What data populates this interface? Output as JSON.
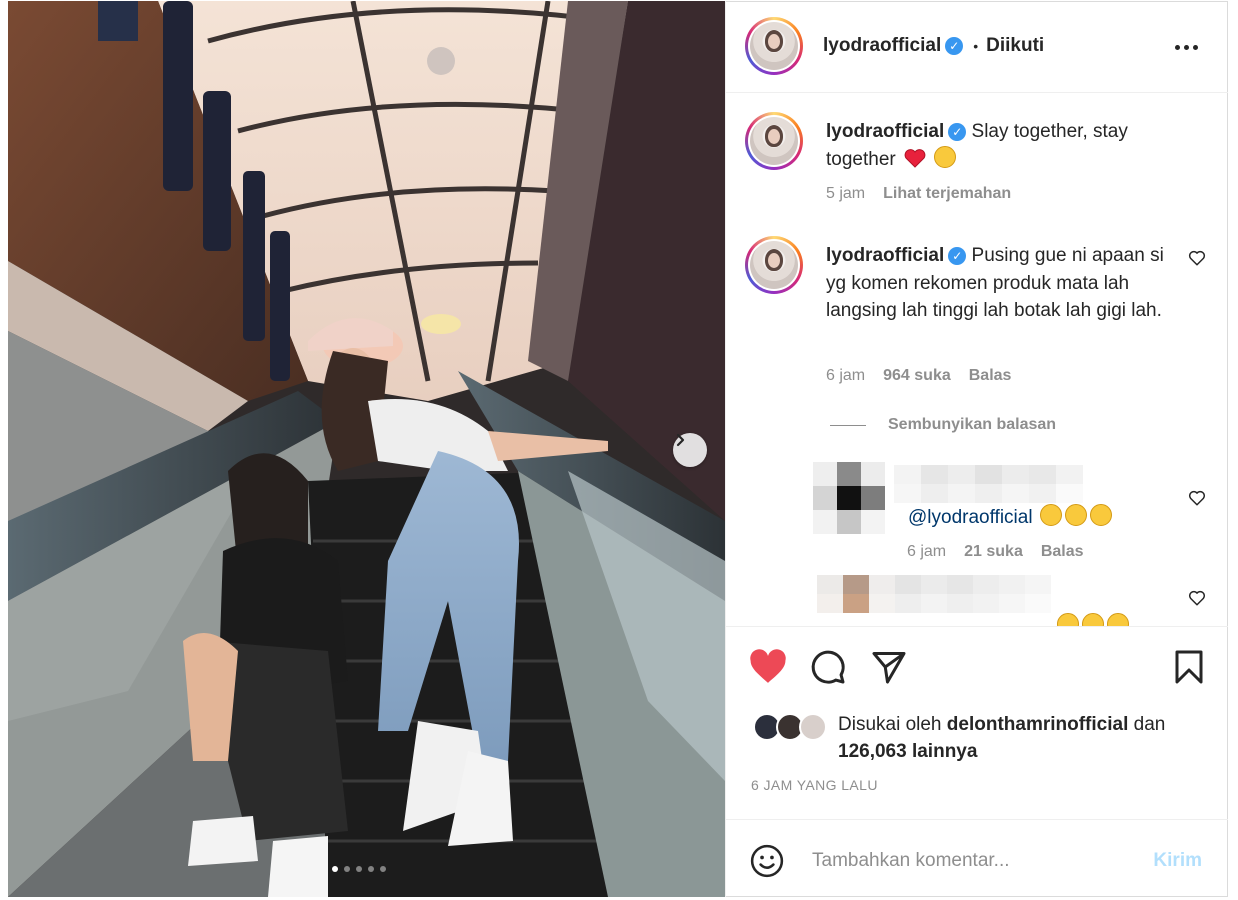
{
  "post": {
    "username": "lyodraofficial",
    "follow_status": "Diikuti",
    "media_dots_total": 5,
    "media_dot_active": 1
  },
  "caption": {
    "username": "lyodraofficial",
    "text": "Slay together, stay together",
    "time": "5 jam",
    "translate": "Lihat terjemahan"
  },
  "comment1": {
    "username": "lyodraofficial",
    "text": "Pusing gue ni apaan si yg komen rekomen produk mata lah langsing lah tinggi lah botak lah gigi lah.",
    "time": "6 jam",
    "likes": "964 suka",
    "reply": "Balas",
    "hide_replies": "Sembunyikan balasan"
  },
  "reply1": {
    "mention": "@lyodraofficial",
    "time": "6 jam",
    "likes": "21 suka",
    "reply": "Balas"
  },
  "likes_summary": {
    "prefix": "Disukai oleh",
    "user": "delonthamrinofficial",
    "conj": "dan",
    "others": "126,063 lainnya"
  },
  "time_ago": "6 JAM YANG LALU",
  "comment_box": {
    "placeholder": "Tambahkan komentar...",
    "post_label": "Kirim"
  },
  "colors": {
    "like_red": "#ed4956",
    "verified_blue": "#3897f0",
    "mention_blue": "#00376b",
    "post_disabled": "#b2dffc"
  }
}
